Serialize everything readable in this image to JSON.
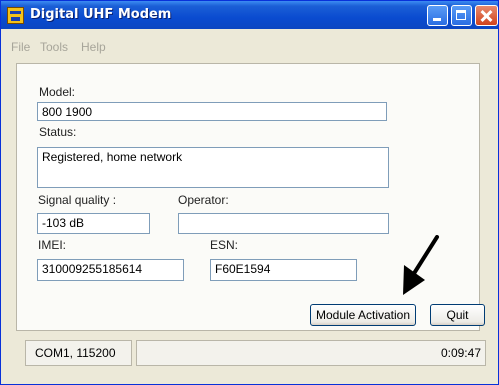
{
  "window": {
    "title": "Digital UHF Modem",
    "icons": {
      "app": "app-icon",
      "minimize": "minimize-icon",
      "maximize": "maximize-icon",
      "close": "close-icon"
    },
    "colors": {
      "titlebar": "#0a4bd0",
      "close": "#d1421c"
    }
  },
  "menu": {
    "file": "File",
    "tools": "Tools",
    "help": "Help"
  },
  "form": {
    "model_label": "Model:",
    "model_value": "800 1900",
    "status_label": "Status:",
    "status_value": "Registered, home network",
    "signal_label": "Signal quality :",
    "signal_value": "-103 dB",
    "operator_label": "Operator:",
    "operator_value": "",
    "imei_label": "IMEI:",
    "imei_value": "310009255185614",
    "esn_label": "ESN:",
    "esn_value": "F60E1594"
  },
  "buttons": {
    "module_activation": "Module Activation",
    "quit": "Quit"
  },
  "statusbar": {
    "connection": "COM1, 115200",
    "elapsed": "0:09:47"
  },
  "annotation": {
    "icon": "arrow-pointer-icon"
  }
}
